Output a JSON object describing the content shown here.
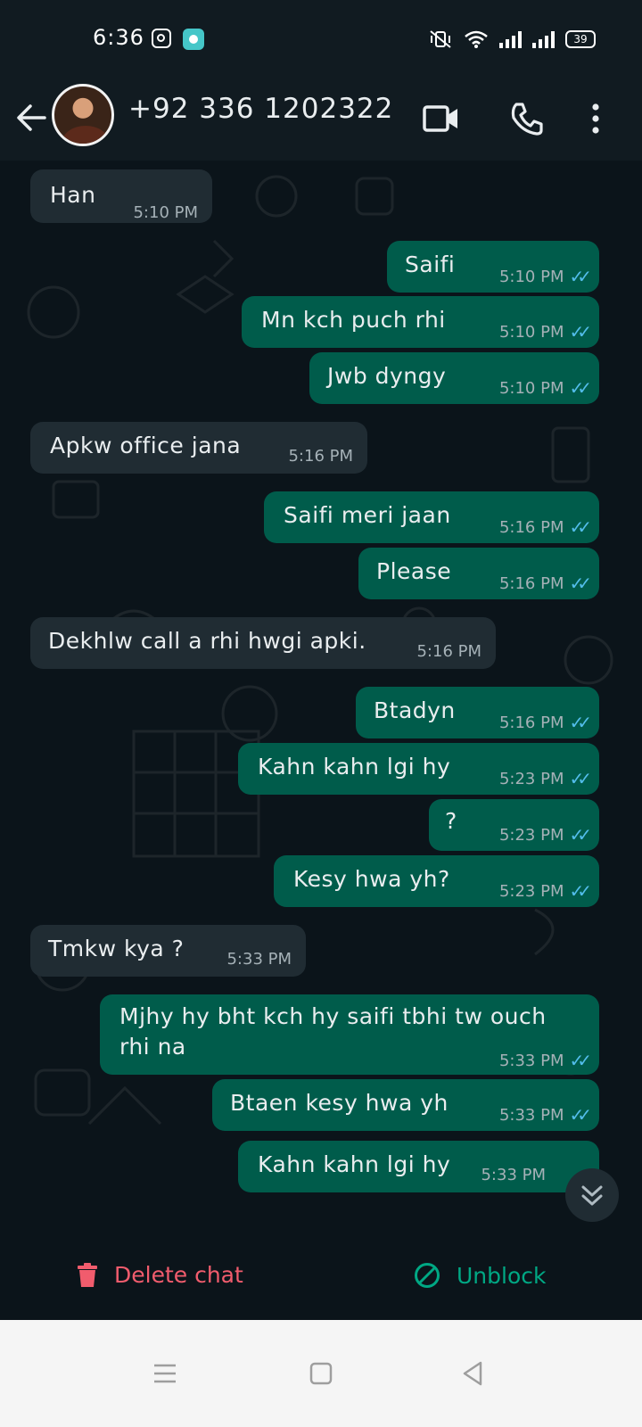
{
  "status_bar": {
    "time": "6:36",
    "battery": "39"
  },
  "header": {
    "contact": "+92 336 1202322",
    "icons": [
      "back-arrow-icon",
      "video-call-icon",
      "voice-call-icon",
      "more-options-icon"
    ]
  },
  "messages": [
    {
      "dir": "in",
      "text": "Han",
      "time": "5:10 PM"
    },
    {
      "dir": "out",
      "text": "Saifi",
      "time": "5:10 PM"
    },
    {
      "dir": "out",
      "text": "Mn kch puch rhi",
      "time": "5:10 PM"
    },
    {
      "dir": "out",
      "text": "Jwb dyngy",
      "time": "5:10 PM"
    },
    {
      "dir": "in",
      "text": "Apkw office jana",
      "time": "5:16 PM"
    },
    {
      "dir": "out",
      "text": "Saifi meri jaan",
      "time": "5:16 PM"
    },
    {
      "dir": "out",
      "text": "Please",
      "time": "5:16 PM"
    },
    {
      "dir": "in",
      "text": "Dekhlw call a rhi hwgi apki.",
      "time": "5:16 PM"
    },
    {
      "dir": "out",
      "text": "Btadyn",
      "time": "5:16 PM"
    },
    {
      "dir": "out",
      "text": "Kahn kahn lgi hy",
      "time": "5:23 PM"
    },
    {
      "dir": "out",
      "text": "?",
      "time": "5:23 PM"
    },
    {
      "dir": "out",
      "text": "Kesy hwa yh?",
      "time": "5:23 PM"
    },
    {
      "dir": "in",
      "text": "Tmkw kya ?",
      "time": "5:33 PM"
    },
    {
      "dir": "out",
      "text_line1": "Mjhy hy bht kch hy saifi tbhi tw ouch",
      "text_line2": "rhi na",
      "time": "5:33 PM"
    },
    {
      "dir": "out",
      "text": "Btaen kesy hwa yh",
      "time": "5:33 PM"
    },
    {
      "dir": "out",
      "text": "Kahn kahn lgi hy",
      "time": "5:33 PM"
    }
  ],
  "actions": {
    "delete_label": "Delete chat",
    "unblock_label": "Unblock"
  },
  "colors": {
    "incoming_bubble": "#202c33",
    "outgoing_bubble": "#005c4b",
    "read_tick": "#53bdeb",
    "delete": "#f15c6d",
    "unblock": "#00a884"
  }
}
